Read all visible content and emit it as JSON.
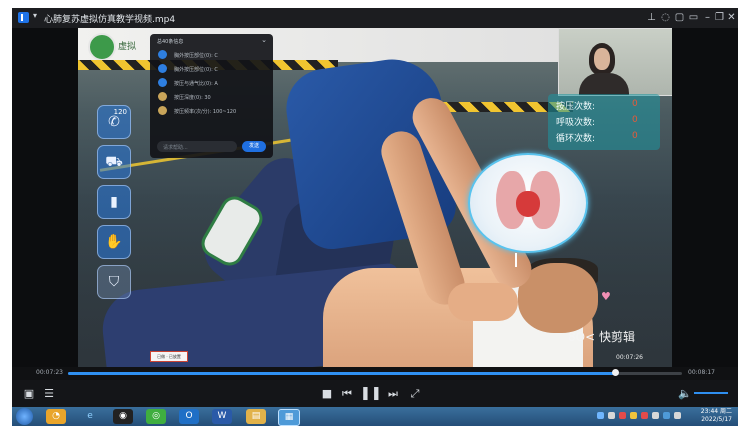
{
  "window": {
    "title": "心肺复苏虚拟仿真教学视频.mp4",
    "title_caret": "▾",
    "controls": [
      "pin",
      "skin",
      "feedback",
      "mini",
      "minimize",
      "maximize",
      "close"
    ]
  },
  "scene": {
    "site_name": "虚拟",
    "left_toolbar": [
      {
        "icon": "phone-icon",
        "label": "120"
      },
      {
        "icon": "ambulance-icon",
        "label": ""
      },
      {
        "icon": "aed-icon",
        "label": ""
      },
      {
        "icon": "gloves-icon",
        "label": ""
      },
      {
        "icon": "shield-icon",
        "label": ""
      }
    ],
    "panel": {
      "title": "总40条信息",
      "close": "⌄",
      "items": [
        {
          "text": "胸外按压部位(0): C",
          "dot": "blue"
        },
        {
          "text": "胸外按压部位(0): C",
          "dot": "blue"
        },
        {
          "text": "按压与通气比(0): A",
          "dot": "blue"
        },
        {
          "text": "按压深度(0): 30",
          "dot": "gold"
        },
        {
          "text": "按压频率(次/分): 100~120",
          "dot": "gold"
        }
      ],
      "input_placeholder": "请求帮助...",
      "send_label": "发送"
    },
    "counters": [
      {
        "label": "按压次数:",
        "value": "0"
      },
      {
        "label": "呼吸次数:",
        "value": "0"
      },
      {
        "label": "循环次数:",
        "value": "0"
      }
    ],
    "watermark": "8O< 快剪辑",
    "scene_time": "00:07:26",
    "scene_label": "已做 · 已放置"
  },
  "player": {
    "time_current": "00:07:23",
    "time_total": "00:08:17",
    "progress": 0.891,
    "accent": "#2f8ff0",
    "controls": [
      "stop",
      "previous",
      "pause",
      "next",
      "fullscreen"
    ],
    "volume": 1.0
  },
  "taskbar": {
    "apps": [
      "start",
      "browser-360",
      "ie",
      "qq",
      "360-browser",
      "outlook",
      "word",
      "explorer",
      "media-player"
    ],
    "time": "23:44 周二",
    "date": "2022/5/17"
  }
}
